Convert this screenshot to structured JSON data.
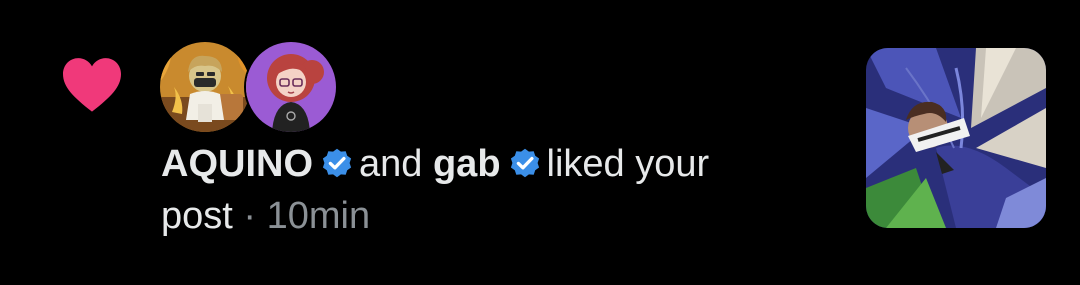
{
  "notification": {
    "user1": "AQUINO",
    "connector": "and",
    "user2": "gab",
    "action_line1": "liked your",
    "action_line2": "post",
    "separator": "·",
    "time": "10min"
  },
  "icons": {
    "like": "heart-icon",
    "verified": "verified-badge-icon"
  },
  "colors": {
    "background": "#000000",
    "heart": "#f0397a",
    "verified": "#3b8fe8",
    "text": "#e7e9ea",
    "meta": "#8b9196"
  }
}
